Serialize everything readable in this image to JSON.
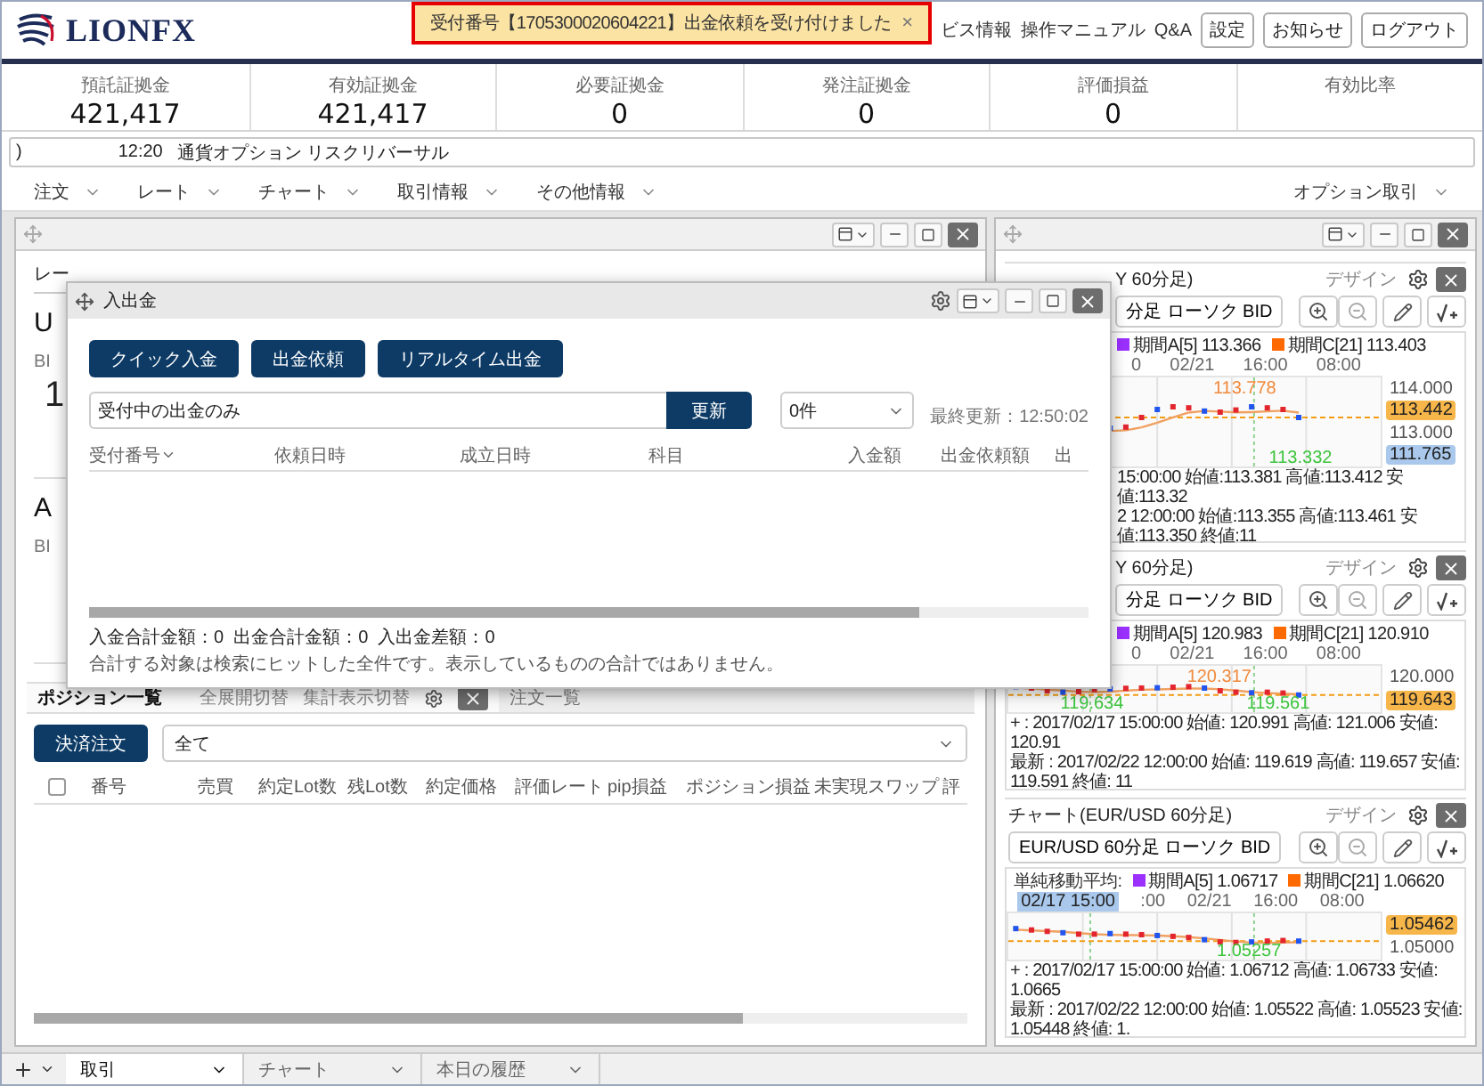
{
  "header": {
    "logo": "LIONFX",
    "links": [
      "ビス情報",
      "操作マニュアル",
      "Q&A"
    ],
    "buttons": [
      "設定",
      "お知らせ",
      "ログアウト"
    ]
  },
  "notification": {
    "message": "受付番号【1705300020604221】出金依頼を受け付けました",
    "close": "×"
  },
  "summary": [
    {
      "label": "預託証拠金",
      "value": "421,417"
    },
    {
      "label": "有効証拠金",
      "value": "421,417"
    },
    {
      "label": "必要証拠金",
      "value": "0"
    },
    {
      "label": "発注証拠金",
      "value": "0"
    },
    {
      "label": "評価損益",
      "value": "0"
    },
    {
      "label": "有効比率"
    }
  ],
  "ticker": {
    "fragment": ")",
    "time": "12:20",
    "headline": "通貨オプション リスクリバーサル"
  },
  "menu": {
    "items": [
      "注文",
      "レート",
      "チャート",
      "取引情報",
      "その他情報"
    ],
    "right": "オプション取引"
  },
  "rate_panel": {
    "tab": "レー",
    "cards": [
      {
        "pair": "U",
        "side": "BI",
        "price": "1"
      },
      {
        "pair": "A",
        "side": "BI"
      }
    ]
  },
  "positions": {
    "tabs": [
      {
        "label": "ポジション一覧",
        "selected": true
      },
      {
        "label": "注文一覧",
        "selected": false
      }
    ],
    "actions": [
      "全展開切替",
      "集計表示切替"
    ],
    "button": "決済注文",
    "filter": "全て",
    "select_all_checked": false,
    "columns": [
      "番号",
      "売買",
      "約定Lot数",
      "残Lot数",
      "約定価格",
      "評価レート",
      "pip損益",
      "ポジション損益",
      "未実現スワップ",
      "評"
    ]
  },
  "dialog": {
    "title": "入出金",
    "buttons": [
      "クイック入金",
      "出金依頼",
      "リアルタイム出金"
    ],
    "filter": "受付中の出金のみ",
    "refresh": "更新",
    "count": "0件",
    "last_updated": "最終更新：12:50:02",
    "columns": [
      "受付番号",
      "依頼日時",
      "成立日時",
      "科目",
      "入金額",
      "出金依頼額",
      "出"
    ],
    "totals": "入金合計金額：0  出金合計金額：0  入出金差額：0",
    "note": "合計する対象は検索にヒットした全件です。表示しているものの合計ではありません。"
  },
  "charts": [
    {
      "title": "Y 60分足)",
      "design": "デザイン",
      "selector": "分足 ローソク BID",
      "legend": [
        {
          "label": "期間A[5] 113.366",
          "color": "#9b30ff"
        },
        {
          "label": "期間C[21] 113.403",
          "color": "#ff6a00"
        }
      ],
      "times": [
        "0",
        "02/21",
        "16:00",
        "08:00"
      ],
      "axis": [
        {
          "text": "114.000",
          "kind": "tick"
        },
        {
          "text": "113.442",
          "kind": "current"
        },
        {
          "text": "113.000",
          "kind": "tick"
        },
        {
          "text": "111.765",
          "kind": "marker"
        }
      ],
      "annotations": [
        {
          "text": "113.778",
          "kind": "high"
        },
        {
          "text": "113.332",
          "kind": "low"
        }
      ],
      "info": [
        "15:00:00 始値:113.381 高値:113.412 安値:113.32",
        "2 12:00:00 始値:113.355 高値:113.461 安値:113.350 終値:11"
      ]
    },
    {
      "title": "Y 60分足)",
      "design": "デザイン",
      "selector": "分足 ローソク BID",
      "legend": [
        {
          "label": "期間A[5] 120.983",
          "color": "#9b30ff"
        },
        {
          "label": "期間C[21] 120.910",
          "color": "#ff6a00"
        }
      ],
      "times": [
        "0",
        "02/21",
        "16:00",
        "08:00"
      ],
      "axis": [
        {
          "text": "120.000",
          "kind": "tick"
        },
        {
          "text": "119.643",
          "kind": "current"
        }
      ],
      "annotations": [
        {
          "text": "120.317",
          "kind": "high"
        },
        {
          "text": "119.634",
          "kind": "low"
        },
        {
          "text": "119.561",
          "kind": "low"
        }
      ],
      "info": [
        "+ : 2017/02/17 15:00:00 始値: 120.991 高値: 121.006 安値: 120.91",
        "最新 : 2017/02/22 12:00:00 始値: 119.619 高値: 119.657 安値: 119.591 終値: 11"
      ]
    },
    {
      "title": "チャート(EUR/USD 60分足)",
      "design": "デザイン",
      "selector": "EUR/USD 60分足 ローソク BID",
      "legend_prefix": "単純移動平均:",
      "legend": [
        {
          "label": "期間A[5] 1.06717",
          "color": "#9b30ff"
        },
        {
          "label": "期間C[21] 1.06620",
          "color": "#ff6a00"
        }
      ],
      "cursor_time": "02/17 15:00",
      "times": [
        ":00",
        "02/21",
        "16:00",
        "08:00"
      ],
      "axis": [
        {
          "text": "1.05462",
          "kind": "current"
        },
        {
          "text": "1.05000",
          "kind": "tick"
        }
      ],
      "annotations": [
        {
          "text": "1.05257",
          "kind": "low"
        }
      ],
      "info": [
        "+ : 2017/02/17 15:00:00 始値: 1.06712 高値: 1.06733 安値: 1.0665",
        "最新 : 2017/02/22 12:00:00 始値: 1.05522 高値: 1.05523 安値: 1.05448 終値: 1."
      ]
    }
  ],
  "bottom_tabs": [
    {
      "label": "取引",
      "selected": true
    },
    {
      "label": "チャート",
      "selected": false
    },
    {
      "label": "本日の履歴",
      "selected": false
    }
  ]
}
